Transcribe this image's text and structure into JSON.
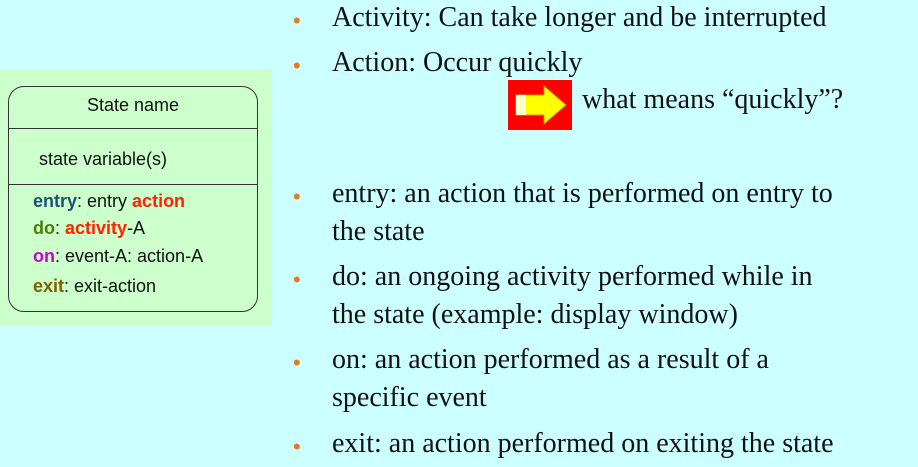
{
  "state_box": {
    "name": "State name",
    "variables": "state variable(s)",
    "entry_kw": "entry",
    "entry_sep": ": entry ",
    "entry_action": "action",
    "do_kw": "do",
    "do_sep": ": ",
    "do_activity": "activity",
    "do_suffix": "-A",
    "on_kw": "on",
    "on_text": ": event-A: action-A",
    "exit_kw": "exit",
    "exit_text": ": exit-action"
  },
  "bullets": {
    "activity": "Activity: Can take longer and be interrupted",
    "action": "Action: Occur quickly",
    "question": "what means “quickly”?",
    "entry_1": "entry: an action that is performed on entry to",
    "entry_2": "the state",
    "do_1": "do: an ongoing activity performed while in",
    "do_2": "the state (example: display window)",
    "on_1": "on: an action performed as a result of a",
    "on_2": "specific event",
    "exit_1": "exit: an action performed on exiting the state",
    "marker": "•"
  },
  "colors": {
    "background": "#ccffff",
    "state_box_bg": "#ccffcc",
    "bullet_marker": "#e87722",
    "arrow_box": "#ff0000",
    "arrow_fill": "#ffff00"
  },
  "icons": {
    "arrow": "right-arrow-icon"
  }
}
